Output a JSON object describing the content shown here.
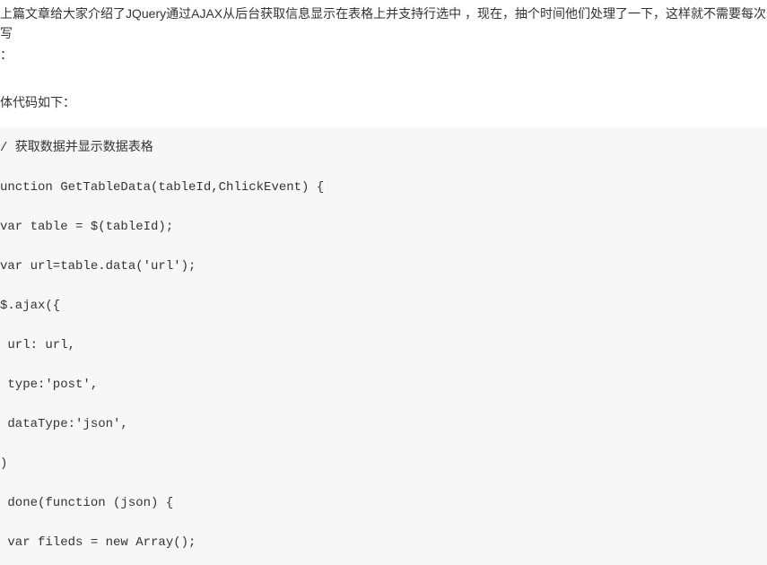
{
  "intro": {
    "line1": "上篇文章给大家介绍了JQuery通过AJAX从后台获取信息显示在表格上并支持行选中  ，现在，抽个时间他们处理了一下，这样就不需要每次写",
    "line2": "："
  },
  "sub_heading": "体代码如下：",
  "code": {
    "lines": [
      "/ 获取数据并显示数据表格",
      "unction GetTableData(tableId,ChlickEvent) {",
      "var table = $(tableId);",
      "var url=table.data('url');",
      "$.ajax({",
      " url: url,",
      " type:'post',",
      " dataType:'json',",
      ")",
      " done(function (json) {",
      " var fileds = new Array();"
    ]
  }
}
